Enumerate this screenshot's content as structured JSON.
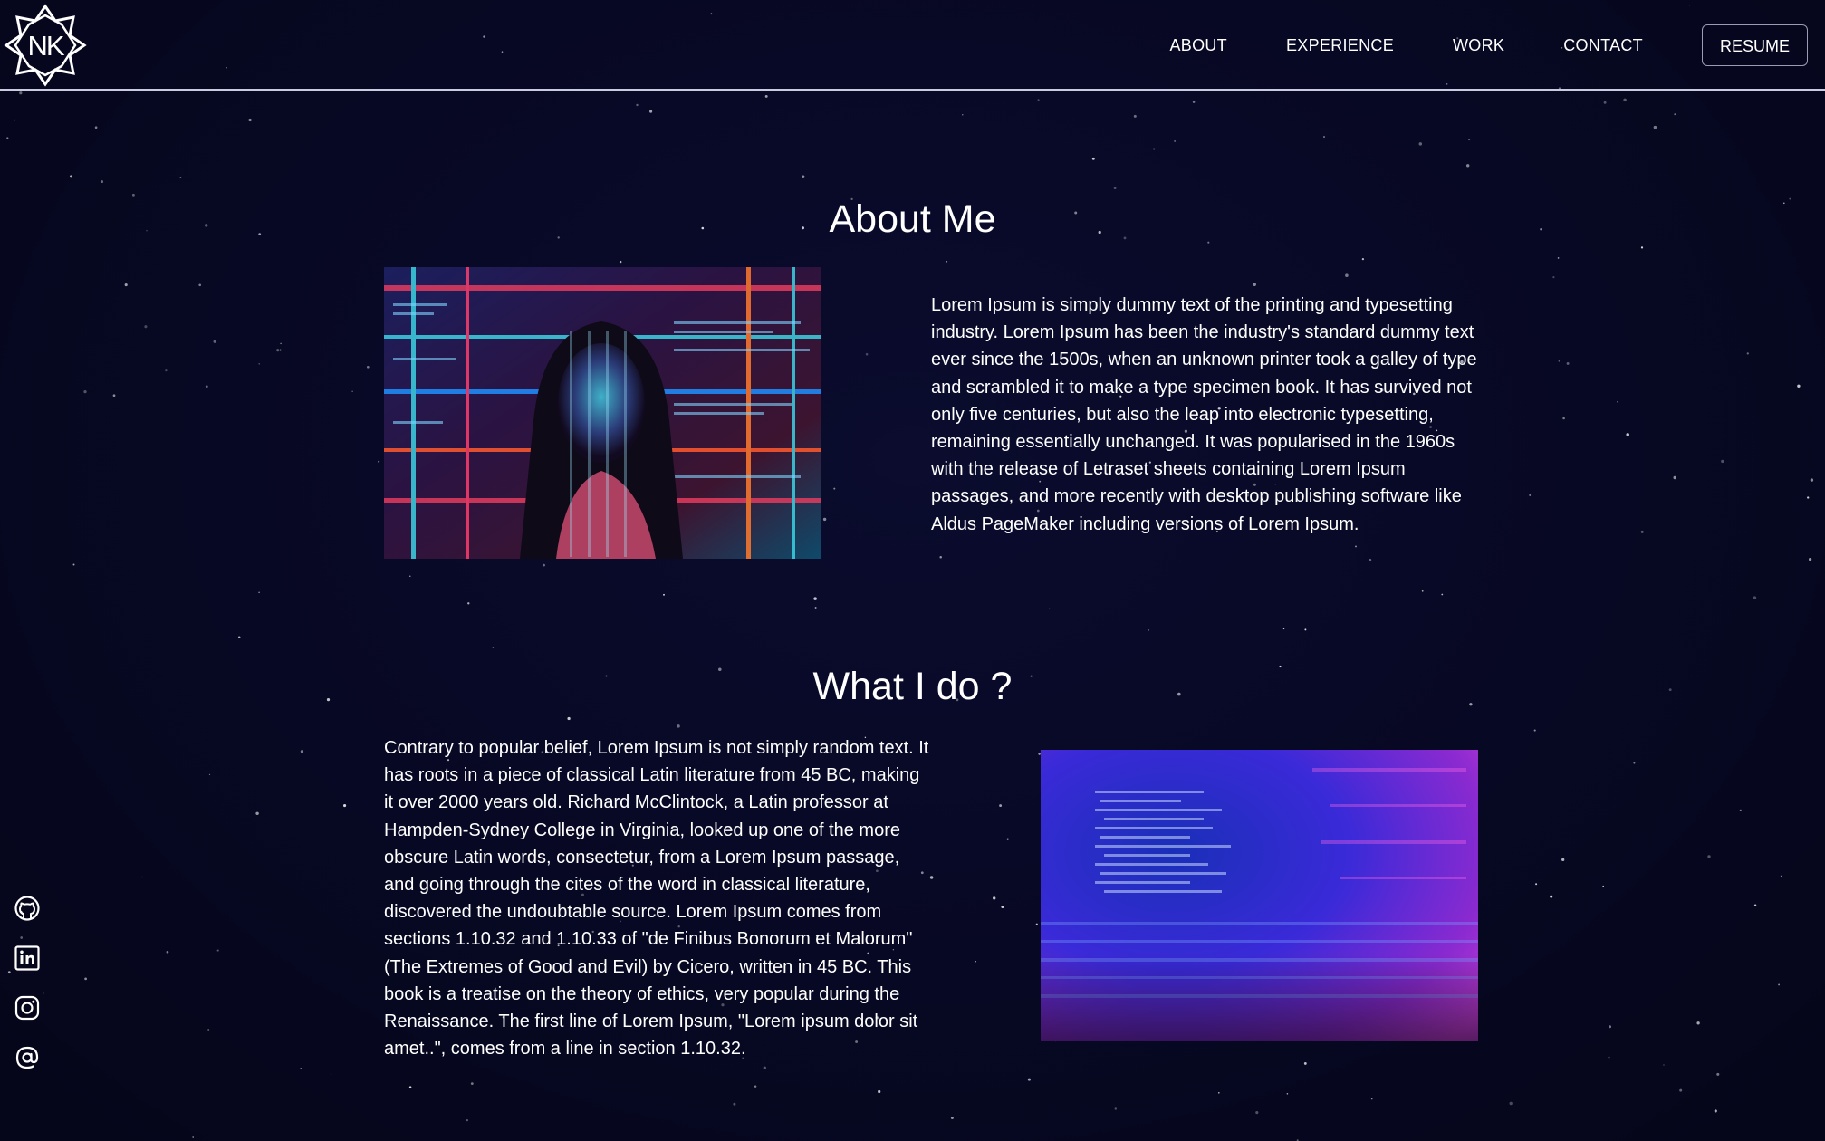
{
  "header": {
    "logo_text": "NK",
    "nav": [
      {
        "label": "ABOUT"
      },
      {
        "label": "EXPERIENCE"
      },
      {
        "label": "WORK"
      },
      {
        "label": "CONTACT"
      }
    ],
    "resume_label": "RESUME"
  },
  "about": {
    "title": "About Me",
    "text": "Lorem Ipsum is simply dummy text of the printing and typesetting industry. Lorem Ipsum has been the industry's standard dummy text ever since the 1500s, when an unknown printer took a galley of type and scrambled it to make a type specimen book. It has survived not only five centuries, but also the leap into electronic typesetting, remaining essentially unchanged. It was popularised in the 1960s with the release of Letraset sheets containing Lorem Ipsum passages, and more recently with desktop publishing software like Aldus PageMaker including versions of Lorem Ipsum."
  },
  "whatido": {
    "title": "What I do ?",
    "text": "Contrary to popular belief, Lorem Ipsum is not simply random text. It has roots in a piece of classical Latin literature from 45 BC, making it over 2000 years old. Richard McClintock, a Latin professor at Hampden-Sydney College in Virginia, looked up one of the more obscure Latin words, consectetur, from a Lorem Ipsum passage, and going through the cites of the word in classical literature, discovered the undoubtable source. Lorem Ipsum comes from sections 1.10.32 and 1.10.33 of \"de Finibus Bonorum et Malorum\" (The Extremes of Good and Evil) by Cicero, written in 45 BC. This book is a treatise on the theory of ethics, very popular during the Renaissance. The first line of Lorem Ipsum, \"Lorem ipsum dolor sit amet..\", comes from a line in section 1.10.32."
  },
  "social": [
    {
      "icon": "github-icon"
    },
    {
      "icon": "linkedin-icon"
    },
    {
      "icon": "instagram-icon"
    },
    {
      "icon": "email-at-icon"
    }
  ],
  "colors": {
    "background": "#070823",
    "text": "#ffffff",
    "header_border": "#c9cbe0"
  }
}
